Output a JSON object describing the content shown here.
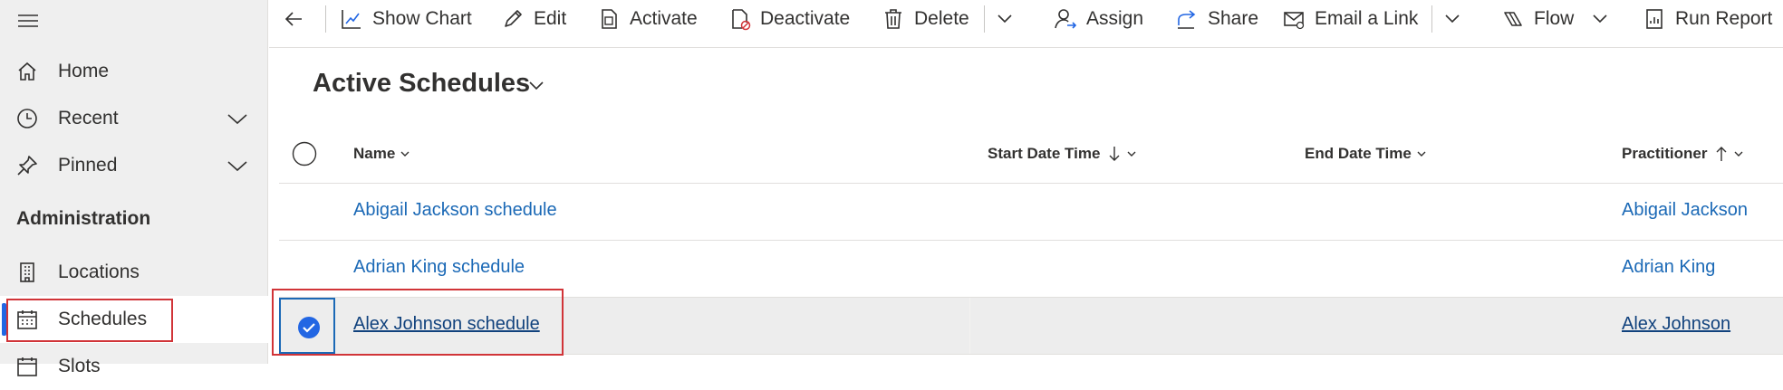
{
  "sidebar": {
    "items": [
      {
        "label": "Home",
        "icon": "home-icon"
      },
      {
        "label": "Recent",
        "icon": "clock-icon"
      },
      {
        "label": "Pinned",
        "icon": "pin-icon"
      }
    ],
    "section_title": "Administration",
    "admin_items": [
      {
        "label": "Locations",
        "icon": "building-icon"
      },
      {
        "label": "Schedules",
        "icon": "calendar-icon",
        "selected": true
      },
      {
        "label": "Slots",
        "icon": "calendar-icon"
      }
    ]
  },
  "toolbar": {
    "show_chart": "Show Chart",
    "edit": "Edit",
    "activate": "Activate",
    "deactivate": "Deactivate",
    "delete": "Delete",
    "assign": "Assign",
    "share": "Share",
    "email_link": "Email a Link",
    "flow": "Flow",
    "run_report": "Run Report"
  },
  "view": {
    "title": "Active Schedules"
  },
  "grid": {
    "columns": {
      "name": "Name",
      "start": "Start Date Time",
      "end": "End Date Time",
      "practitioner": "Practitioner"
    },
    "rows": [
      {
        "name": "Abigail Jackson schedule",
        "practitioner": "Abigail Jackson",
        "selected": false
      },
      {
        "name": "Adrian King schedule",
        "practitioner": "Adrian King",
        "selected": false
      },
      {
        "name": "Alex Johnson schedule",
        "practitioner": "Alex Johnson",
        "selected": true
      }
    ]
  },
  "colors": {
    "accent": "#2266e3",
    "link": "#1b69b6",
    "highlight": "#d13438",
    "selected_row": "#ededed"
  }
}
